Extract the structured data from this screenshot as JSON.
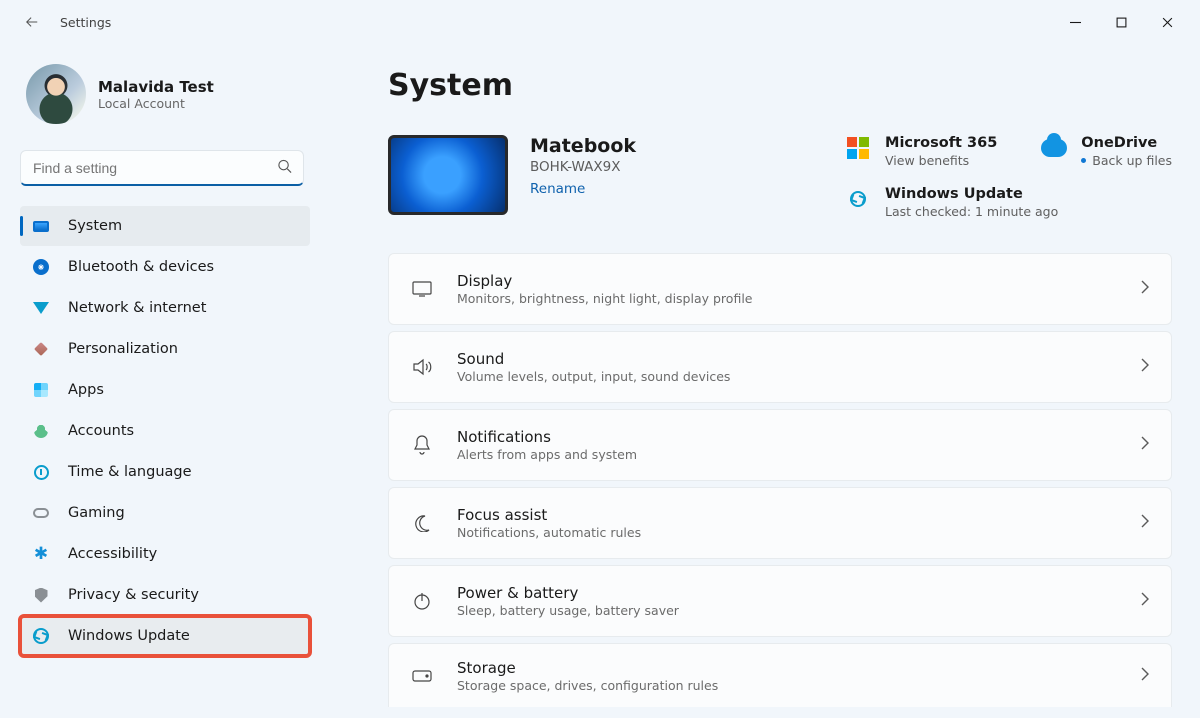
{
  "app_title": "Settings",
  "profile": {
    "name": "Malavida Test",
    "sub": "Local Account"
  },
  "search": {
    "placeholder": "Find a setting"
  },
  "sidebar": {
    "items": [
      {
        "label": "System"
      },
      {
        "label": "Bluetooth & devices"
      },
      {
        "label": "Network & internet"
      },
      {
        "label": "Personalization"
      },
      {
        "label": "Apps"
      },
      {
        "label": "Accounts"
      },
      {
        "label": "Time & language"
      },
      {
        "label": "Gaming"
      },
      {
        "label": "Accessibility"
      },
      {
        "label": "Privacy & security"
      },
      {
        "label": "Windows Update"
      }
    ]
  },
  "page_title": "System",
  "device": {
    "name": "Matebook",
    "model": "BOHK-WAX9X",
    "rename_label": "Rename"
  },
  "promos": {
    "m365": {
      "title": "Microsoft 365",
      "sub": "View benefits"
    },
    "onedrive": {
      "title": "OneDrive",
      "sub": "Back up files"
    },
    "wu": {
      "title": "Windows Update",
      "sub": "Last checked: 1 minute ago"
    }
  },
  "cards": [
    {
      "title": "Display",
      "sub": "Monitors, brightness, night light, display profile"
    },
    {
      "title": "Sound",
      "sub": "Volume levels, output, input, sound devices"
    },
    {
      "title": "Notifications",
      "sub": "Alerts from apps and system"
    },
    {
      "title": "Focus assist",
      "sub": "Notifications, automatic rules"
    },
    {
      "title": "Power & battery",
      "sub": "Sleep, battery usage, battery saver"
    },
    {
      "title": "Storage",
      "sub": "Storage space, drives, configuration rules"
    }
  ]
}
